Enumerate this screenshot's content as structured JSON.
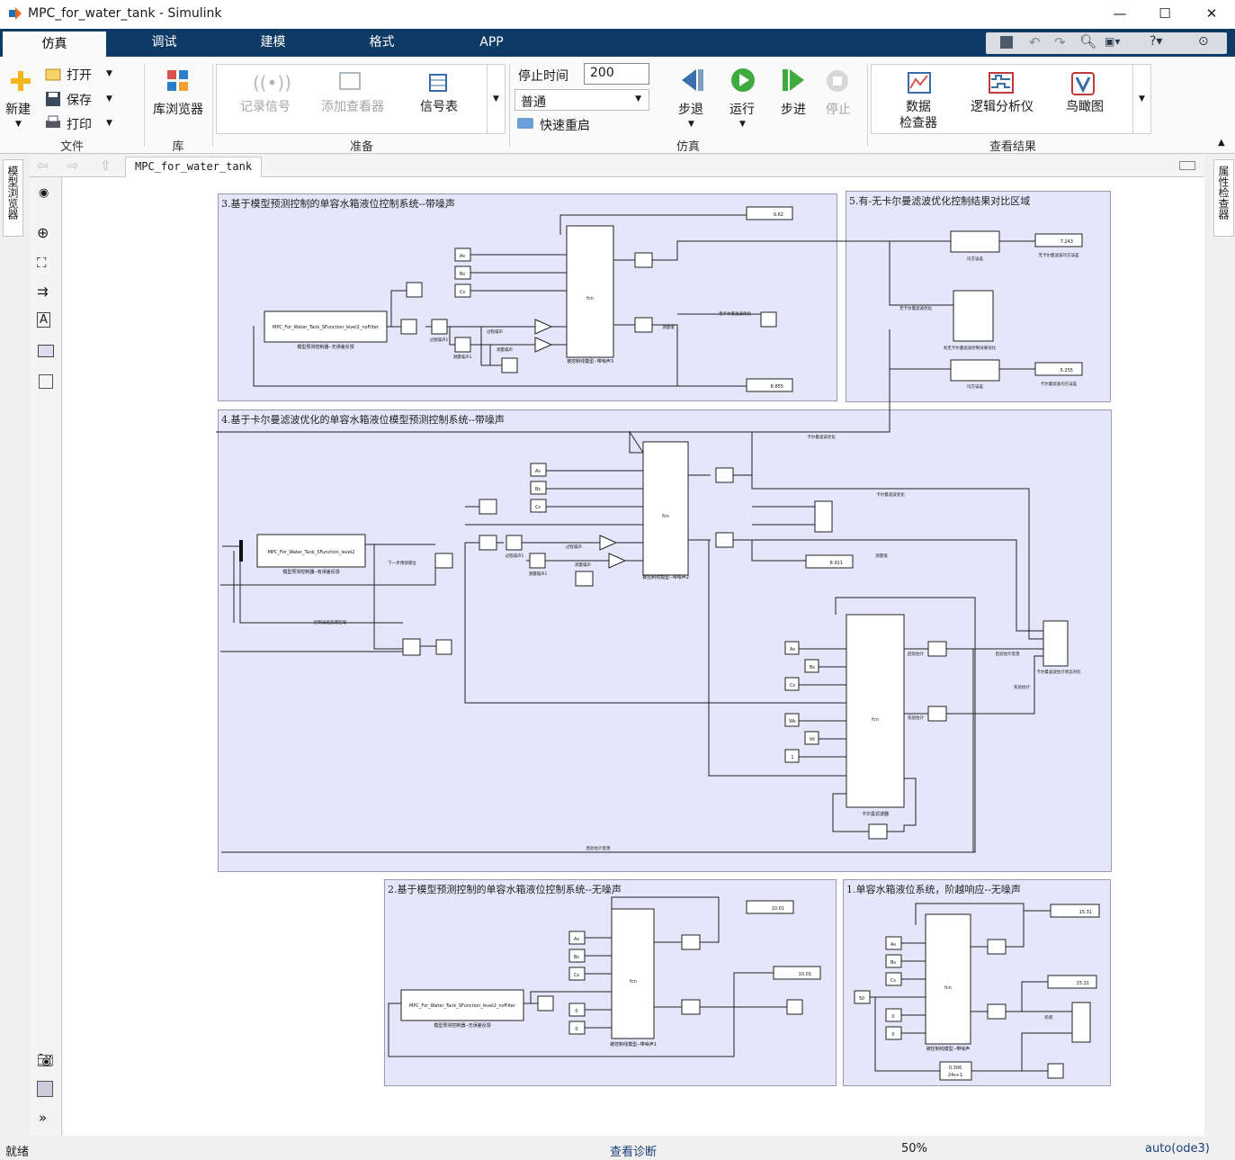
{
  "window": {
    "title": "MPC_for_water_tank - Simulink",
    "controls": [
      "—",
      "☐",
      "✕"
    ]
  },
  "tabs": [
    "仿真",
    "调试",
    "建模",
    "格式",
    "APP"
  ],
  "ribbon": {
    "new": "新建",
    "open": "打开",
    "save": "保存",
    "print": "打印",
    "file_group": "文件",
    "library": "库浏览器",
    "library_group": "库",
    "log_signal": "记录信号",
    "add_viewer": "添加查看器",
    "signal_table": "信号表",
    "prepare_group": "准备",
    "stop_time_label": "停止时间",
    "stop_time_value": "200",
    "mode": "普通",
    "fast_restart": "快速重启",
    "step_back": "步退",
    "run": "运行",
    "step_forward": "步进",
    "stop": "停止",
    "sim_group": "仿真",
    "data_inspector": [
      "数据",
      "检查器"
    ],
    "logic_analyzer": "逻辑分析仪",
    "birdseye": "鸟瞰图",
    "results_group": "查看结果"
  },
  "side": {
    "model_browser": "模型浏览器",
    "property_inspector": "属性检查器"
  },
  "breadcrumb": "MPC_for_water_tank",
  "areas": {
    "a3": "3.基于模型预测控制的单容水箱液位控制系统--带噪声",
    "a5": "5.有-无卡尔曼滤波优化控制结果对比区域",
    "a4": "4.基于卡尔曼滤波优化的单容水箱液位模型预测控制系统--带噪声",
    "a2": "2.基于模型预测控制的单容水箱液位控制系统--无噪声",
    "a1": "1.单容水箱液位系统，阶越响应--无噪声"
  },
  "displays": {
    "d3a": "9.62",
    "d3b": "8.855",
    "d5a": "7.243",
    "d5b": "5.255",
    "d4": "8.911",
    "d2a": "10.01",
    "d2b": "10.01",
    "d1a": "15.31",
    "d1b": "15.31"
  },
  "blocks": {
    "sfun_nofilter": "MPC_For_Water_Tank_SFunction_level2_noFilter",
    "sfun_level2": "MPC_For_Water_Tank_SFunction_level2",
    "ctrl_nofeedback": "模型预测控制器--无误差反馈",
    "ctrl_feedback": "模型预测控制器--有误差反馈",
    "plant3": "被控制线模型--带噪声3",
    "plant4": "被控制线模型--带噪声2",
    "plant2": "被控制线模型--带噪声1",
    "plant1": "被控制线模型--带噪声",
    "kalman": "卡尔曼滤波器",
    "process_noise": "过程噪声",
    "measure_noise": "测量噪声",
    "process_noise1": "过程噪声1",
    "measure_noise1": "测量噪声1",
    "mse": "均方误差",
    "mse_a": "均方误差",
    "no_kalman_mse": "无卡尔曼滤波均方误差",
    "kalman_mse": "卡尔曼滤波均方误差",
    "no_kalman_opt": "无卡尔曼滤波优化",
    "compare_scope": "有无卡尔曼滤波控制效果对比",
    "kalman_opt": "卡尔曼滤波优化",
    "measured": "测量值",
    "next_pred": "下一步预测液位",
    "err_feedback": "控制误差反馈区域",
    "post_est": "后验估计",
    "prior_est": "先验估计",
    "post_feedback": "后验估计反馈",
    "kalman_compare": "卡尔曼滤波估计状态对比",
    "tf_num": "0.306",
    "tf_den": "24s+1",
    "const50": "50",
    "const1": "1",
    "const0": "0",
    "step": "阶跃",
    "fcn": "fcn",
    "inA": "As",
    "inB": "Bs",
    "inC": "Cs",
    "inW": "Wk",
    "inV": "Vk"
  },
  "status": {
    "ready": "就绪",
    "diagnostics": "查看诊断",
    "zoom": "50%",
    "solver": "auto(ode3)"
  }
}
